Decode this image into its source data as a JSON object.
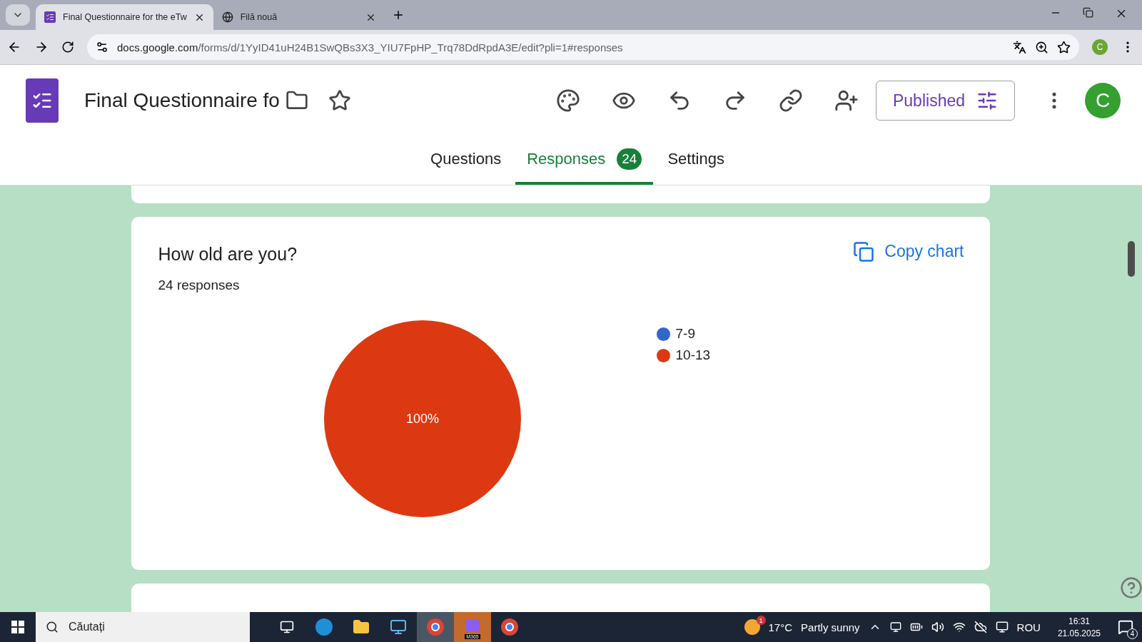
{
  "browser": {
    "tabs": [
      {
        "title": "Final Questionnaire for the eTw",
        "selected": true
      },
      {
        "title": "Filă nouă",
        "selected": false
      }
    ],
    "address": {
      "host": "docs.google.com",
      "path": "/forms/d/1YyID41uH24B1SwQBs3X3_YIU7FpHP_Trq78DdRpdA3E/edit?pli=1#responses"
    },
    "profile_initial": "C"
  },
  "form": {
    "title": "Final Questionnaire fo",
    "publish_button": "Published",
    "avatar_initial": "C",
    "tabs": [
      {
        "label": "Questions",
        "selected": false
      },
      {
        "label": "Responses",
        "selected": true,
        "badge": "24"
      },
      {
        "label": "Settings",
        "selected": false
      }
    ]
  },
  "question_card": {
    "title": "How old are you?",
    "count": "24 responses",
    "copy_button": "Copy chart",
    "chart_data": {
      "type": "pie",
      "categories": [
        "7-9",
        "10-13"
      ],
      "series": [
        {
          "values": [
            0,
            100
          ]
        }
      ],
      "colors": [
        "#3366cc",
        "#dc3912"
      ],
      "value_labels": [
        null,
        "100%"
      ]
    }
  },
  "taskbar": {
    "search_placeholder": "Căutați",
    "app_label": "M365",
    "weather_badge": "1",
    "temperature": "17°C",
    "weather": "Partly sunny",
    "language": "ROU",
    "time": "16:31",
    "date": "21.05.2025",
    "notifications": "4"
  }
}
